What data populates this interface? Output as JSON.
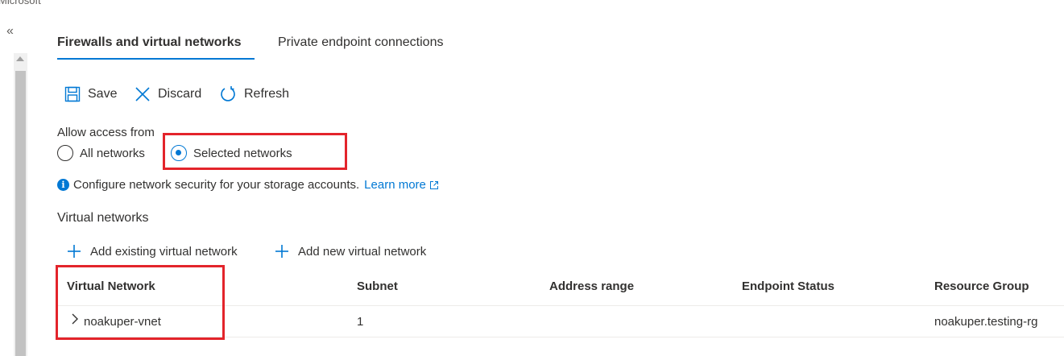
{
  "brand": "Microsoft",
  "tabs": [
    {
      "label": "Firewalls and virtual networks",
      "active": true
    },
    {
      "label": "Private endpoint connections",
      "active": false
    }
  ],
  "toolbar": {
    "save_label": "Save",
    "discard_label": "Discard",
    "refresh_label": "Refresh"
  },
  "access": {
    "label": "Allow access from",
    "options": [
      {
        "label": "All networks",
        "selected": false
      },
      {
        "label": "Selected networks",
        "selected": true
      }
    ]
  },
  "info": {
    "text": "Configure network security for your storage accounts.",
    "link_label": "Learn more"
  },
  "vnet": {
    "section_title": "Virtual networks",
    "add_existing_label": "Add existing virtual network",
    "add_new_label": "Add new virtual network"
  },
  "table": {
    "columns": [
      "Virtual Network",
      "Subnet",
      "Address range",
      "Endpoint Status",
      "Resource Group"
    ],
    "rows": [
      {
        "virtual_network": "noakuper-vnet",
        "subnet": "1",
        "address_range": "",
        "endpoint_status": "",
        "resource_group": "noakuper.testing-rg"
      }
    ]
  },
  "colors": {
    "accent": "#0078d4",
    "highlight": "#e3242b",
    "text": "#323130"
  },
  "icons": [
    "collapse-icon",
    "save-icon",
    "discard-icon",
    "refresh-icon",
    "info-icon",
    "external-link-icon",
    "plus-icon",
    "chevron-right-icon"
  ]
}
